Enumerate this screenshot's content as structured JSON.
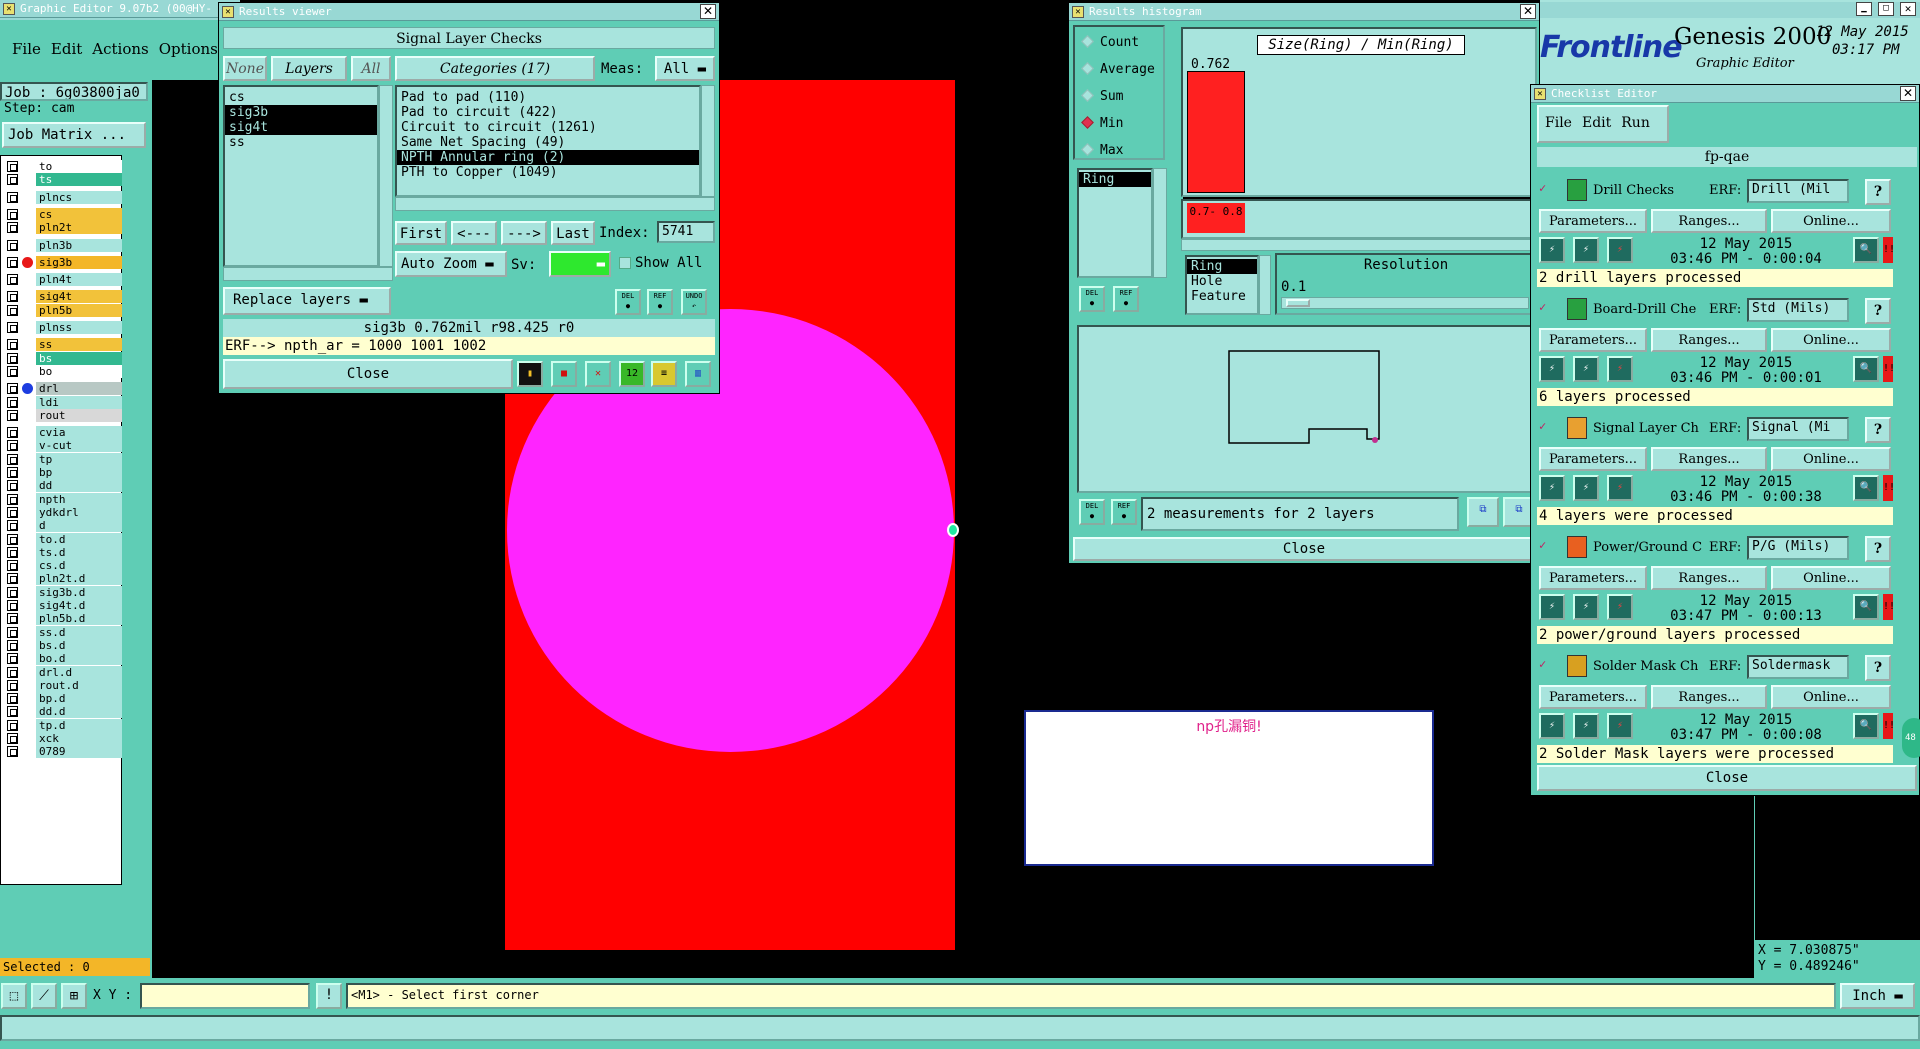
{
  "main_window": {
    "title": "Graphic Editor 9.07b2 (00@HY-",
    "menu": [
      "File",
      "Edit",
      "Actions",
      "Options"
    ],
    "job_label": "Job : 6g03800ja0",
    "step_label": "Step: cam",
    "job_matrix_button": "Job Matrix ...",
    "selected_label": "Selected : 0"
  },
  "layers": [
    {
      "name": "to",
      "color": "w"
    },
    {
      "name": "ts",
      "color": "g"
    },
    {
      "name": "plncs",
      "color": ""
    },
    {
      "name": "cs",
      "color": "y"
    },
    {
      "name": "pln2t",
      "color": "y"
    },
    {
      "name": "pln3b",
      "color": ""
    },
    {
      "name": "sig3b",
      "color": "r",
      "dot": "#e81818"
    },
    {
      "name": "pln4t",
      "color": ""
    },
    {
      "name": "sig4t",
      "color": "y"
    },
    {
      "name": "pln5b",
      "color": "y"
    },
    {
      "name": "plnss",
      "color": ""
    },
    {
      "name": "ss",
      "color": "y"
    },
    {
      "name": "bs",
      "color": "g"
    },
    {
      "name": "bo",
      "color": "w"
    },
    {
      "name": "drl",
      "color": "gr",
      "dot": "#1d3de0"
    },
    {
      "name": "ldi",
      "color": ""
    },
    {
      "name": "rout",
      "color": "k"
    },
    {
      "name": "cvia",
      "color": ""
    },
    {
      "name": "v-cut",
      "color": ""
    },
    {
      "name": "tp",
      "color": ""
    },
    {
      "name": "bp",
      "color": ""
    },
    {
      "name": "dd",
      "color": ""
    },
    {
      "name": "npth",
      "color": ""
    },
    {
      "name": "ydkdrl",
      "color": ""
    },
    {
      "name": "d",
      "color": ""
    },
    {
      "name": "to.d",
      "color": ""
    },
    {
      "name": "ts.d",
      "color": ""
    },
    {
      "name": "cs.d",
      "color": ""
    },
    {
      "name": "pln2t.d",
      "color": ""
    },
    {
      "name": "sig3b.d",
      "color": ""
    },
    {
      "name": "sig4t.d",
      "color": ""
    },
    {
      "name": "pln5b.d",
      "color": ""
    },
    {
      "name": "ss.d",
      "color": ""
    },
    {
      "name": "bs.d",
      "color": ""
    },
    {
      "name": "bo.d",
      "color": ""
    },
    {
      "name": "drl.d",
      "color": ""
    },
    {
      "name": "rout.d",
      "color": ""
    },
    {
      "name": "bp.d",
      "color": ""
    },
    {
      "name": "dd.d",
      "color": ""
    },
    {
      "name": "tp.d",
      "color": ""
    },
    {
      "name": "xck",
      "color": ""
    },
    {
      "name": "0789",
      "color": ""
    }
  ],
  "results_viewer": {
    "title": "Results viewer",
    "heading": "Signal Layer Checks",
    "none_btn": "None",
    "layers_btn": "Layers",
    "all_btn": "All",
    "categories_btn": "Categories (17)",
    "meas_label": "Meas:",
    "meas_value": "All",
    "layer_list": [
      "cs",
      "sig3b",
      "sig4t",
      "ss"
    ],
    "categories": [
      "Pad to pad (110)",
      "Pad to circuit (422)",
      "Circuit to circuit (1261)",
      "Same Net Spacing (49)",
      "NPTH Annular ring (2)",
      "PTH to Copper (1049)"
    ],
    "first_btn": "First",
    "prev_btn": "<---",
    "next_btn": "--->",
    "last_btn": "Last",
    "index_label": "Index:",
    "index_value": "5741",
    "auto_zoom": "Auto Zoom",
    "sv_label": "Sv:",
    "show_all": "Show All",
    "replace_layers": "Replace layers",
    "status": "sig3b 0.762mil  r98.425  r0",
    "erf": "ERF--> npth_ar = 1000 1001 1002",
    "close": "Close",
    "del": "DEL",
    "ref": "REF",
    "undo": "UNDO"
  },
  "histogram": {
    "title": "Results histogram",
    "modes": [
      "Count",
      "Average",
      "Sum",
      "Min",
      "Max"
    ],
    "selected_mode": "Min",
    "chart_title": "Size(Ring) / Min(Ring)",
    "bar_value_label": "0.762",
    "bar_range_label": "0.7- 0.8",
    "list_item": "Ring",
    "list2": [
      "Ring",
      "Hole",
      "Feature"
    ],
    "resolution_label": "Resolution",
    "resolution_value": "0.1",
    "status": "2 measurements for 2 layers",
    "close": "Close",
    "del": "DEL",
    "ref": "REF"
  },
  "brand": {
    "logo": "Frontline",
    "product": "Genesis 2000",
    "subtitle": "Graphic Editor",
    "date": "12 May 2015",
    "time": "03:17 PM"
  },
  "checklist": {
    "title": "Checklist Editor",
    "menu": [
      "File",
      "Edit",
      "Run"
    ],
    "name": "fp-qae",
    "erf_label": "ERF:",
    "params": "Parameters...",
    "ranges": "Ranges...",
    "online": "Online...",
    "help": "?",
    "close": "Close",
    "items": [
      {
        "name": "Drill Checks",
        "erf": "Drill (Mil",
        "date": "12 May 2015",
        "time": "03:46 PM - 0:00:04",
        "status": "2 drill layers processed",
        "icon_color": "#28a040"
      },
      {
        "name": "Board-Drill Che",
        "erf": "Std (Mils)",
        "date": "12 May 2015",
        "time": "03:46 PM - 0:00:01",
        "status": "6 layers processed",
        "icon_color": "#28a040"
      },
      {
        "name": "Signal Layer Ch",
        "erf": "Signal (Mi",
        "date": "12 May 2015",
        "time": "03:46 PM - 0:00:38",
        "status": "4 layers were processed",
        "icon_color": "#e8a030"
      },
      {
        "name": "Power/Ground C",
        "erf": "P/G (Mils)",
        "date": "12 May 2015",
        "time": "03:47 PM - 0:00:13",
        "status": "2 power/ground layers processed",
        "icon_color": "#e86020"
      },
      {
        "name": "Solder Mask Ch",
        "erf": "Soldermask",
        "date": "12 May 2015",
        "time": "03:47 PM - 0:00:08",
        "status": "2 Solder Mask layers were processed",
        "icon_color": "#d8a020"
      }
    ]
  },
  "canvas": {
    "note_text": "np孔漏铜!",
    "coord_x": "X = 7.030875\"",
    "coord_y": "Y = 0.489246\""
  },
  "bottom": {
    "xy_label": "X Y :",
    "xy_value": "",
    "prompt": "<M1> - Select first corner",
    "unit": "Inch"
  },
  "colors": {
    "pad_red": "#ff0000",
    "hole_magenta": "#ff24ff",
    "teal": "#5fcdb5",
    "light_teal": "#a8e4dd"
  }
}
